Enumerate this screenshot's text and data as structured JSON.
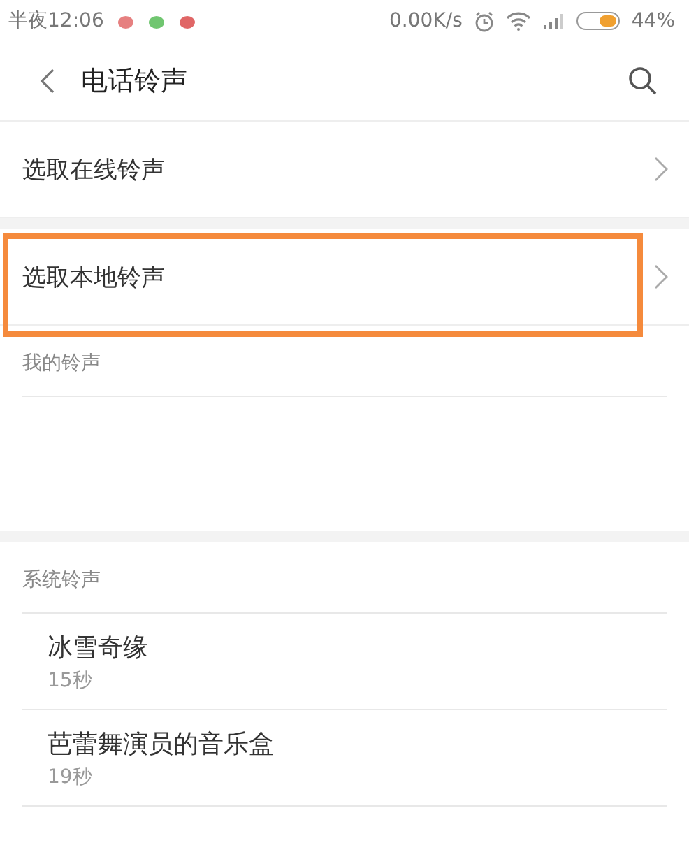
{
  "status_bar": {
    "time": "半夜12:06",
    "speed": "0.00K/s",
    "battery": "44%"
  },
  "header": {
    "title": "电话铃声"
  },
  "options": [
    {
      "label": "选取在线铃声",
      "highlighted": false
    },
    {
      "label": "选取本地铃声",
      "highlighted": true
    }
  ],
  "sections": [
    {
      "title": "我的铃声"
    },
    {
      "title": "系统铃声",
      "items": [
        {
          "name": "冰雪奇缘",
          "duration": "15秒"
        },
        {
          "name": "芭蕾舞演员的音乐盒",
          "duration": "19秒"
        }
      ]
    }
  ]
}
